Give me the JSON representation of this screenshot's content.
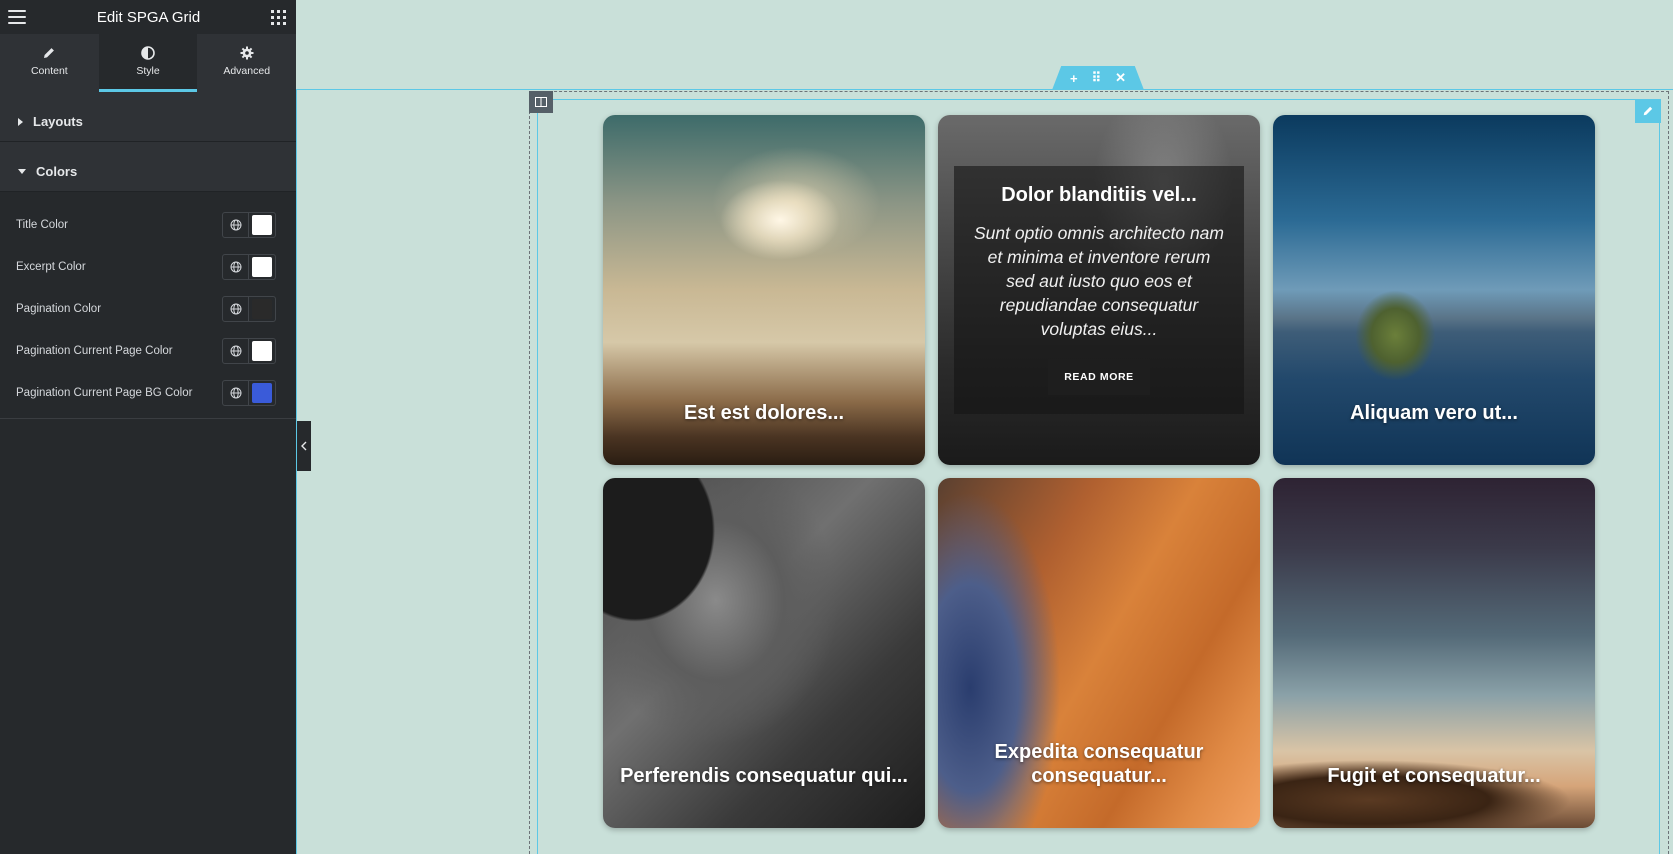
{
  "panel": {
    "title": "Edit SPGA Grid",
    "tabs": [
      {
        "label": "Content",
        "icon": "pencil-icon"
      },
      {
        "label": "Style",
        "icon": "half-circle-icon"
      },
      {
        "label": "Advanced",
        "icon": "gear-icon"
      }
    ],
    "active_tab": "Style",
    "sections": {
      "layouts": {
        "label": "Layouts",
        "state": "collapsed"
      },
      "colors": {
        "label": "Colors",
        "state": "expanded"
      }
    },
    "color_controls": [
      {
        "label": "Title Color",
        "value": "#ffffff"
      },
      {
        "label": "Excerpt Color",
        "value": "#ffffff"
      },
      {
        "label": "Pagination Color",
        "value": "#2a2a2a"
      },
      {
        "label": "Pagination Current Page Color",
        "value": "#ffffff"
      },
      {
        "label": "Pagination Current Page BG Color",
        "value": "#3a5bd9"
      }
    ]
  },
  "canvas": {
    "accent_color": "#5cc8e6",
    "section_handle": {
      "add": "+",
      "move": "⠿",
      "close": "✕"
    },
    "grid_items": [
      {
        "title": "Est est dolores..."
      },
      {
        "title": "Dolor blanditiis vel...",
        "excerpt": "Sunt optio omnis architecto nam et minima et inventore rerum sed aut iusto quo eos et repudiandae consequatur voluptas eius...",
        "read_more": "READ MORE",
        "hovered": true
      },
      {
        "title": "Aliquam vero ut..."
      },
      {
        "title": "Perferendis consequatur qui..."
      },
      {
        "title": "Expedita consequatur consequatur..."
      },
      {
        "title": "Fugit et consequatur..."
      }
    ]
  }
}
